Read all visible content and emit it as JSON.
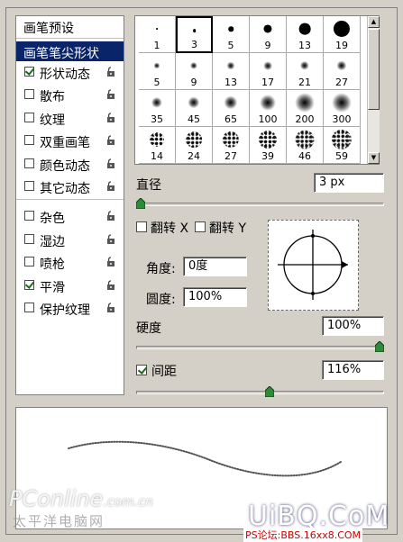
{
  "sidebar": {
    "header": "画笔预设",
    "items": [
      {
        "label": "画笔笔尖形状",
        "checkbox": null,
        "selected": true,
        "lock": false
      },
      {
        "label": "形状动态",
        "checkbox": true,
        "selected": false,
        "lock": true
      },
      {
        "label": "散布",
        "checkbox": false,
        "selected": false,
        "lock": true
      },
      {
        "label": "纹理",
        "checkbox": false,
        "selected": false,
        "lock": true
      },
      {
        "label": "双重画笔",
        "checkbox": false,
        "selected": false,
        "lock": true
      },
      {
        "label": "颜色动态",
        "checkbox": false,
        "selected": false,
        "lock": true
      },
      {
        "label": "其它动态",
        "checkbox": false,
        "selected": false,
        "lock": true
      },
      {
        "label": "杂色",
        "checkbox": false,
        "selected": false,
        "lock": true
      },
      {
        "label": "湿边",
        "checkbox": false,
        "selected": false,
        "lock": true
      },
      {
        "label": "喷枪",
        "checkbox": false,
        "selected": false,
        "lock": true
      },
      {
        "label": "平滑",
        "checkbox": true,
        "selected": false,
        "lock": true
      },
      {
        "label": "保护纹理",
        "checkbox": false,
        "selected": false,
        "lock": true
      }
    ]
  },
  "brushes": [
    {
      "size": "1",
      "kind": "hard",
      "selected": false
    },
    {
      "size": "3",
      "kind": "hard",
      "selected": true
    },
    {
      "size": "5",
      "kind": "hard",
      "selected": false
    },
    {
      "size": "9",
      "kind": "hard",
      "selected": false
    },
    {
      "size": "13",
      "kind": "hard",
      "selected": false
    },
    {
      "size": "19",
      "kind": "hard",
      "selected": false
    },
    {
      "size": "5",
      "kind": "soft",
      "selected": false
    },
    {
      "size": "9",
      "kind": "soft",
      "selected": false
    },
    {
      "size": "13",
      "kind": "soft",
      "selected": false
    },
    {
      "size": "17",
      "kind": "soft",
      "selected": false
    },
    {
      "size": "21",
      "kind": "soft",
      "selected": false
    },
    {
      "size": "27",
      "kind": "soft",
      "selected": false
    },
    {
      "size": "35",
      "kind": "soft",
      "selected": false
    },
    {
      "size": "45",
      "kind": "soft",
      "selected": false
    },
    {
      "size": "65",
      "kind": "soft",
      "selected": false
    },
    {
      "size": "100",
      "kind": "soft",
      "selected": false
    },
    {
      "size": "200",
      "kind": "soft",
      "selected": false
    },
    {
      "size": "300",
      "kind": "soft",
      "selected": false
    },
    {
      "size": "14",
      "kind": "spray",
      "selected": false
    },
    {
      "size": "24",
      "kind": "spray",
      "selected": false
    },
    {
      "size": "27",
      "kind": "spray",
      "selected": false
    },
    {
      "size": "39",
      "kind": "spray",
      "selected": false
    },
    {
      "size": "46",
      "kind": "spray",
      "selected": false
    },
    {
      "size": "59",
      "kind": "spray",
      "selected": false
    }
  ],
  "diameter": {
    "label": "直径",
    "value": "3 px",
    "slider_fraction": 0.0
  },
  "flip_x": {
    "label": "翻转 X",
    "checked": false
  },
  "flip_y": {
    "label": "翻转 Y",
    "checked": false
  },
  "angle": {
    "label": "角度:",
    "value": "0度"
  },
  "roundness": {
    "label": "圆度:",
    "value": "100%"
  },
  "hardness": {
    "label": "硬度",
    "value": "100%",
    "slider_fraction": 1.0
  },
  "spacing": {
    "label": "间距",
    "value": "116%",
    "checked": true,
    "slider_fraction": 0.54
  },
  "watermarks": {
    "pconline": "PConline",
    "pconline_domain": ".com.cn",
    "pconline_cn": "太平洋电脑网",
    "uibq": "UiBQ.CoM",
    "psforum": "PS论坛:BBS.16xx8.COM"
  },
  "colors": {
    "selection": "#0a246a",
    "panel": "#d4d0c8",
    "knob": "#2e8b3a"
  }
}
